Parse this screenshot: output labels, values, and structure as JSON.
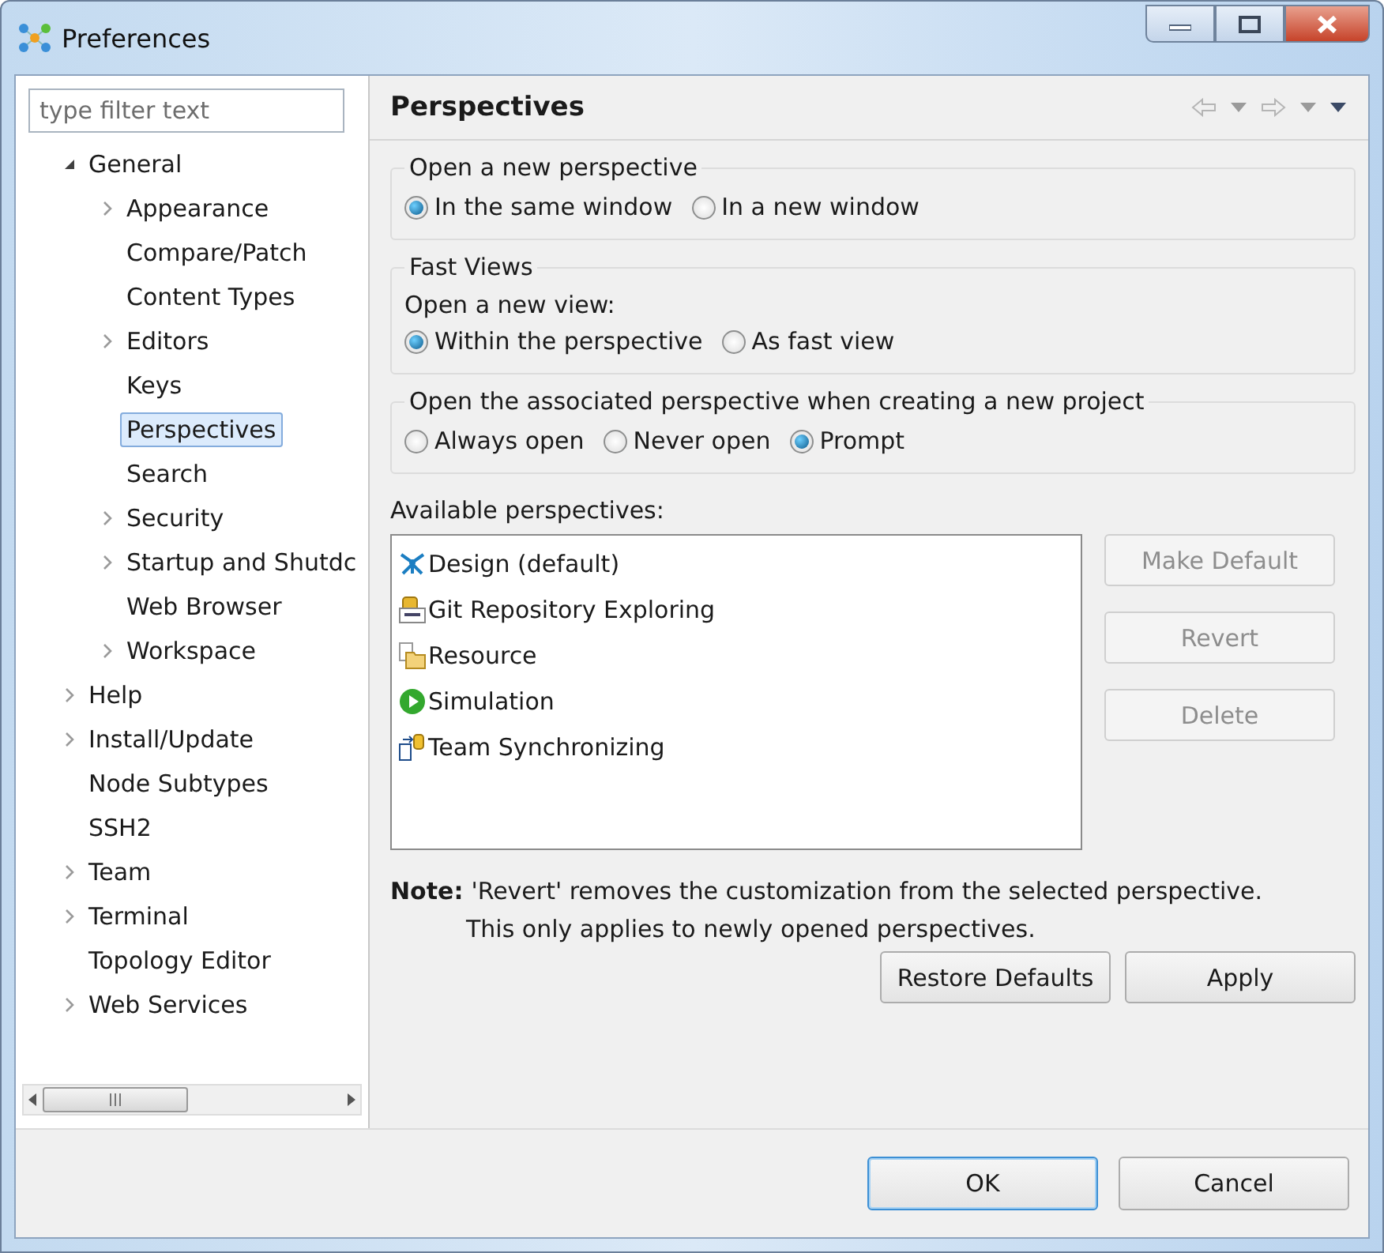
{
  "window": {
    "title": "Preferences"
  },
  "filter": {
    "placeholder": "type filter text"
  },
  "tree": [
    {
      "label": "General",
      "expandable": true,
      "expanded": true,
      "selected": false,
      "children": [
        {
          "label": "Appearance",
          "expandable": true,
          "expanded": false,
          "selected": false
        },
        {
          "label": "Compare/Patch",
          "expandable": false,
          "selected": false
        },
        {
          "label": "Content Types",
          "expandable": false,
          "selected": false
        },
        {
          "label": "Editors",
          "expandable": true,
          "expanded": false,
          "selected": false
        },
        {
          "label": "Keys",
          "expandable": false,
          "selected": false
        },
        {
          "label": "Perspectives",
          "expandable": false,
          "selected": true
        },
        {
          "label": "Search",
          "expandable": false,
          "selected": false
        },
        {
          "label": "Security",
          "expandable": true,
          "expanded": false,
          "selected": false
        },
        {
          "label": "Startup and Shutdc",
          "expandable": true,
          "expanded": false,
          "selected": false
        },
        {
          "label": "Web Browser",
          "expandable": false,
          "selected": false
        },
        {
          "label": "Workspace",
          "expandable": true,
          "expanded": false,
          "selected": false
        }
      ]
    },
    {
      "label": "Help",
      "expandable": true,
      "expanded": false,
      "selected": false
    },
    {
      "label": "Install/Update",
      "expandable": true,
      "expanded": false,
      "selected": false
    },
    {
      "label": "Node Subtypes",
      "expandable": false,
      "selected": false
    },
    {
      "label": "SSH2",
      "expandable": false,
      "selected": false
    },
    {
      "label": "Team",
      "expandable": true,
      "expanded": false,
      "selected": false
    },
    {
      "label": "Terminal",
      "expandable": true,
      "expanded": false,
      "selected": false
    },
    {
      "label": "Topology Editor",
      "expandable": false,
      "selected": false
    },
    {
      "label": "Web Services",
      "expandable": true,
      "expanded": false,
      "selected": false
    }
  ],
  "page": {
    "title": "Perspectives"
  },
  "groups": [
    {
      "title": "Open a new perspective",
      "options": [
        {
          "label": "In the same window",
          "selected": true
        },
        {
          "label": "In a new window",
          "selected": false
        }
      ]
    },
    {
      "title": "Fast Views",
      "subtitle": "Open a new view:",
      "options": [
        {
          "label": "Within the perspective",
          "selected": true
        },
        {
          "label": "As fast view",
          "selected": false
        }
      ]
    },
    {
      "title": "Open the associated perspective when creating a new project",
      "options": [
        {
          "label": "Always open",
          "selected": false
        },
        {
          "label": "Never open",
          "selected": false
        },
        {
          "label": "Prompt",
          "selected": true
        }
      ]
    }
  ],
  "available": {
    "label": "Available perspectives:",
    "items": [
      {
        "label": "Design (default)",
        "kind": "design"
      },
      {
        "label": "Git Repository Exploring",
        "kind": "git"
      },
      {
        "label": "Resource",
        "kind": "resource"
      },
      {
        "label": "Simulation",
        "kind": "simulation"
      },
      {
        "label": "Team Synchronizing",
        "kind": "team"
      }
    ]
  },
  "side_buttons": [
    {
      "label": "Make Default",
      "disabled": true
    },
    {
      "label": "Revert",
      "disabled": true
    },
    {
      "label": "Delete",
      "disabled": true
    }
  ],
  "note": {
    "label": "Note:",
    "lines": [
      "'Revert' removes the customization from the selected perspective.",
      "This only applies to newly opened perspectives."
    ]
  },
  "page_buttons": [
    "Restore Defaults",
    "Apply"
  ],
  "dialog_buttons": [
    {
      "label": "OK",
      "default": true
    },
    {
      "label": "Cancel",
      "default": false
    }
  ]
}
